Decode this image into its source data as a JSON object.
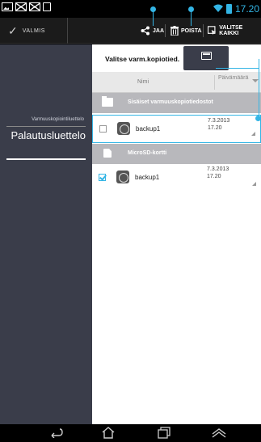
{
  "status_bar": {
    "time": "17.20",
    "left_icons": [
      "image-notification-icon",
      "mail-icon",
      "mail-icon",
      "sd-card-icon"
    ],
    "right_icons": [
      "wifi-icon",
      "battery-icon"
    ]
  },
  "action_bar": {
    "done_label": "VALMIS",
    "share_label": "JAA",
    "delete_label": "POISTA",
    "select_all_label": "VALITSE KAIKKI"
  },
  "left_panel": {
    "list_label": "Varmuuskopiointiluettelo",
    "restore_label": "Palautusluettelo"
  },
  "right_panel": {
    "title": "Valitse varm.kopiotied.",
    "columns": {
      "name": "Nimi",
      "date": "Päivämäärä"
    },
    "sections": [
      {
        "label": "Sisäiset varmuuskopiotiedostot",
        "icon": "folder-icon",
        "rows": [
          {
            "name": "backup1",
            "date": "7.3.2013 17.20",
            "checked": false
          }
        ]
      },
      {
        "label": "MicroSD-kortti",
        "icon": "sd-card-icon",
        "rows": [
          {
            "name": "backup1",
            "date": "7.3.2013 17.20",
            "checked": true
          }
        ]
      }
    ]
  },
  "colors": {
    "accent": "#33b5e5",
    "left_panel_bg": "#3a3d4a",
    "section_bg": "#b8b8bc"
  }
}
